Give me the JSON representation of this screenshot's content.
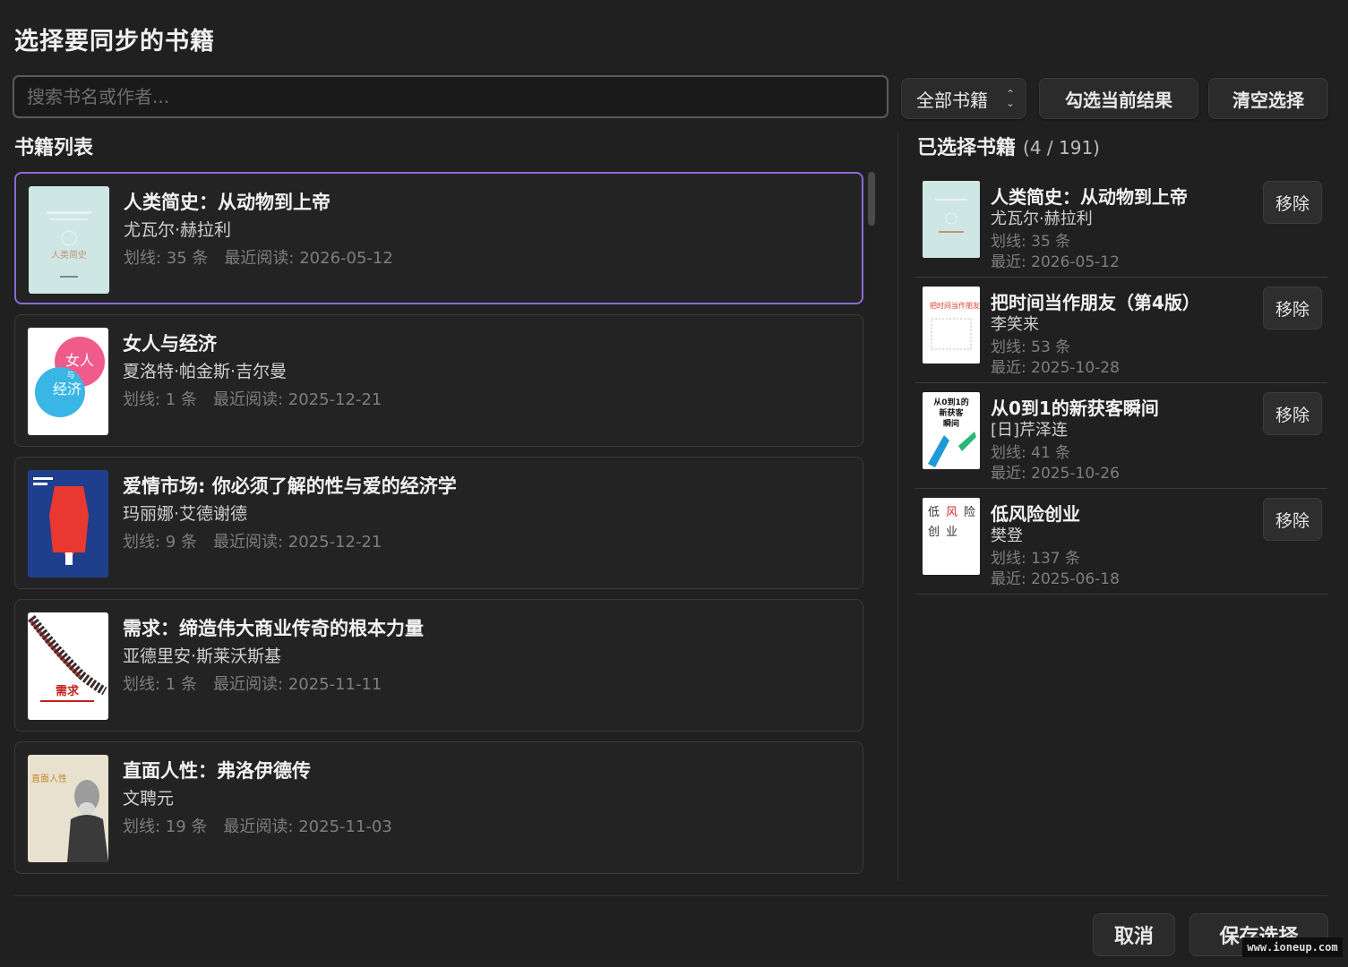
{
  "dialog": {
    "title": "选择要同步的书籍"
  },
  "toolbar": {
    "search_placeholder": "搜索书名或作者...",
    "search_value": "",
    "filter_label": "全部书籍",
    "check_label": "勾选当前结果",
    "clear_label": "清空选择"
  },
  "book_list": {
    "heading": "书籍列表",
    "items": [
      {
        "title": "人类简史：从动物到上帝",
        "author": "尤瓦尔·赫拉利",
        "highlights": "划线: 35 条",
        "last_read": "最近阅读: 2026-05-12",
        "cover_color": "#cfe7e4"
      },
      {
        "title": "女人与经济",
        "author": "夏洛特·帕金斯·吉尔曼",
        "highlights": "划线: 1 条",
        "last_read": "最近阅读: 2025-12-21",
        "cover_color": "#ffffff"
      },
      {
        "title": "爱情市场: 你必须了解的性与爱的经济学",
        "author": "玛丽娜·艾德谢德",
        "highlights": "划线: 9 条",
        "last_read": "最近阅读: 2025-12-21",
        "cover_color": "#1f3e8c"
      },
      {
        "title": "需求：缔造伟大商业传奇的根本力量",
        "author": "亚德里安·斯莱沃斯基",
        "highlights": "划线: 1 条",
        "last_read": "最近阅读: 2025-11-11",
        "cover_color": "#ffffff"
      },
      {
        "title": "直面人性：弗洛伊德传",
        "author": "文聘元",
        "highlights": "划线: 19 条",
        "last_read": "最近阅读: 2025-11-03",
        "cover_color": "#e8e1cf"
      }
    ]
  },
  "selected": {
    "heading": "已选择书籍",
    "count": "(4 / 191)",
    "remove_label": "移除",
    "items": [
      {
        "title": "人类简史：从动物到上帝",
        "author": "尤瓦尔·赫拉利",
        "highlights": "划线: 35 条",
        "last_read": "最近: 2026-05-12"
      },
      {
        "title": "把时间当作朋友（第4版）",
        "author": "李笑来",
        "highlights": "划线: 53 条",
        "last_read": "最近: 2025-10-28"
      },
      {
        "title": "从0到1的新获客瞬间",
        "author": "[日]芹泽连",
        "highlights": "划线: 41 条",
        "last_read": "最近: 2025-10-26"
      },
      {
        "title": "低风险创业",
        "author": "樊登",
        "highlights": "划线: 137 条",
        "last_read": "最近: 2025-06-18"
      }
    ]
  },
  "cover_text": {
    "women_economy": [
      "女人",
      "与",
      "经济"
    ],
    "demand": "需求",
    "sapiens": "人类简史",
    "time_friend": "把时间当作朋友",
    "zero_to_one": [
      "从0到1的",
      "新获客",
      "瞬间"
    ],
    "low_risk": [
      "低",
      "风",
      "险",
      "创",
      "业"
    ],
    "facing": "直面人性"
  },
  "footer": {
    "cancel_label": "取消",
    "save_label": "保存选择",
    "watermark": "www.ioneup.com"
  },
  "colors": {
    "accent_border": "#8a6ad6",
    "background": "#202020"
  }
}
